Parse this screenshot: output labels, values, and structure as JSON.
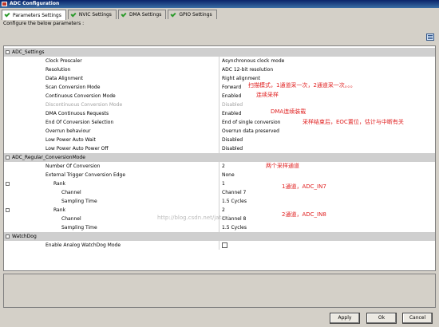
{
  "window": {
    "title": "ADC Configuration"
  },
  "tabs": [
    {
      "label": "Parameters Settings",
      "active": true
    },
    {
      "label": "NVIC Settings",
      "active": false
    },
    {
      "label": "DMA Settings",
      "active": false
    },
    {
      "label": "GPIO Settings",
      "active": false
    }
  ],
  "instruction": "Configure the below parameters :",
  "groups": {
    "adc_settings": "ADC_Settings",
    "regular_conversion": "ADC_Regular_ConversionMode",
    "watchdog": "WatchDog"
  },
  "adc_settings": [
    {
      "name": "Clock Prescaler",
      "value": "Asynchronous clock mode"
    },
    {
      "name": "Resolution",
      "value": "ADC 12-bit resolution"
    },
    {
      "name": "Data Alignment",
      "value": "Right alignment"
    },
    {
      "name": "Scan Conversion Mode",
      "value": "Forward"
    },
    {
      "name": "Continuous Conversion Mode",
      "value": "Enabled"
    },
    {
      "name": "Discontinuous Conversion Mode",
      "value": "Disabled"
    },
    {
      "name": "DMA Continuous Requests",
      "value": "Enabled"
    },
    {
      "name": "End Of Conversion Selection",
      "value": "End of single conversion"
    },
    {
      "name": "Overrun behaviour",
      "value": "Overrun data preserved"
    },
    {
      "name": "Low Power Auto Wait",
      "value": "Disabled"
    },
    {
      "name": "Low Power Auto Power Off",
      "value": "Disabled"
    }
  ],
  "regular_conversion": {
    "number_of_conversion": {
      "name": "Number Of Conversion",
      "value": "2"
    },
    "external_trigger": {
      "name": "External Trigger Conversion Edge",
      "value": "None"
    },
    "ranks": [
      {
        "name": "Rank",
        "value": "1",
        "channel_name": "Channel",
        "channel": "Channel 7",
        "sampling_name": "Sampling Time",
        "sampling": "1.5 Cycles"
      },
      {
        "name": "Rank",
        "value": "2",
        "channel_name": "Channel",
        "channel": "Channel 8",
        "sampling_name": "Sampling Time",
        "sampling": "1.5 Cycles"
      }
    ]
  },
  "watchdog": {
    "name": "Enable Analog WatchDog Mode",
    "checked": false
  },
  "annotations": {
    "scan": "扫描模式，1通道采一次，2通道采一次。。。",
    "continuous": "连续采样",
    "dma": "DMA连续装载",
    "eoc": "采样结束后，EOC置位，估计与中断有关",
    "two_channels": "两个采样通道",
    "channel1": "1通道，ADC_IN7",
    "channel2": "2通道，ADC_IN8"
  },
  "watermark": "http://blog.csdn.net/jatani",
  "buttons": {
    "apply": "Apply",
    "ok": "Ok",
    "cancel": "Cancel"
  }
}
